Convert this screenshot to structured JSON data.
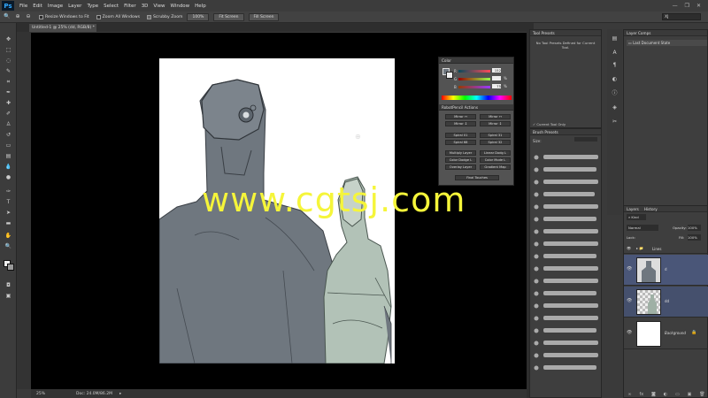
{
  "app": {
    "logo": "Ps"
  },
  "menu": [
    "File",
    "Edit",
    "Image",
    "Layer",
    "Type",
    "Select",
    "Filter",
    "3D",
    "View",
    "Window",
    "Help"
  ],
  "window_controls": [
    "—",
    "❐",
    "✕"
  ],
  "options_bar": {
    "resize_windows": "Resize Windows to Fit",
    "zoom_all": "Zoom All Windows",
    "scrubby_zoom": "Scrubby Zoom",
    "btn_100": "100%",
    "fit_screen": "Fit Screen",
    "fill_screen": "Fill Screen",
    "workspace": "XJ"
  },
  "document": {
    "tab_title": "Untitled-1 @ 25% (dd, RGB/8) *"
  },
  "watermark": "www.cgtsj.com",
  "status": {
    "zoom": "25%",
    "doc_info": "Doc: 24.0M/86.2M"
  },
  "color_panel": {
    "title": "Color",
    "r_value": "152",
    "g_value": "",
    "b_value": "75",
    "unit": "%"
  },
  "actions_panel": {
    "title": "RobotPencil Actions",
    "buttons": [
      "Mirror ↔",
      "Mirror ↔",
      "Mirror ↕",
      "Mirror ↕",
      "Spiral 01",
      "Spiral 31",
      "Spiral 68",
      "Spiral 32",
      "Multiply Layer",
      "Linear Dodg L",
      "Color Dodge L",
      "Color Mode L",
      "Overlay Layer",
      "Gradient Map",
      "Final Touches"
    ]
  },
  "tool_presets": {
    "title": "Tool Presets",
    "empty_msg_1": "No Tool Presets Defined for Current",
    "empty_msg_2": "Tool.",
    "current_only": "Current Tool Only"
  },
  "brush_presets": {
    "title": "Brush Presets",
    "size_label": "Size:"
  },
  "layer_comps": {
    "title": "Layer Comps",
    "last_state": "Last Document State"
  },
  "layers_panel": {
    "tabs": [
      "Layers",
      "History"
    ],
    "kind": "Kind",
    "blend_mode": "Normal",
    "opacity_label": "Opacity:",
    "opacity_value": "100%",
    "lock_label": "Lock:",
    "fill_label": "Fill:",
    "fill_value": "100%",
    "layers": [
      {
        "name": "Lines"
      },
      {
        "name": "d"
      },
      {
        "name": "dd"
      },
      {
        "name": "Background"
      }
    ]
  },
  "icons": {
    "toolbar": [
      "move-icon",
      "marquee-icon",
      "lasso-icon",
      "quick-select-icon",
      "crop-icon",
      "eyedropper-icon",
      "healing-icon",
      "brush-icon",
      "stamp-icon",
      "history-brush-icon",
      "eraser-icon",
      "gradient-icon",
      "blur-icon",
      "dodge-icon",
      "pen-icon",
      "type-icon",
      "path-select-icon",
      "shape-icon",
      "hand-icon",
      "zoom-icon"
    ]
  }
}
